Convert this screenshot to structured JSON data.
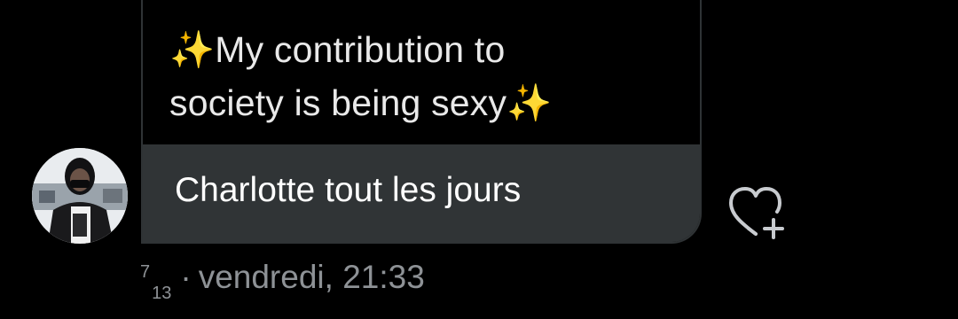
{
  "story_reply": {
    "quoted_story": {
      "caption_line1": "✨My contribution to",
      "caption_line2": "society is being sexy✨"
    },
    "reply_message": "Charlotte tout les jours"
  },
  "timestamp": {
    "count_top": "7",
    "count_bottom": "13",
    "separator": "·",
    "day_time": "vendredi, 21:33"
  },
  "icons": {
    "like": "heart-plus-icon",
    "sparkles": "sparkles-icon"
  },
  "colors": {
    "background": "#000000",
    "bubble": "#303436",
    "meta_text": "#8e9296",
    "sparkle": "#f5c518"
  }
}
